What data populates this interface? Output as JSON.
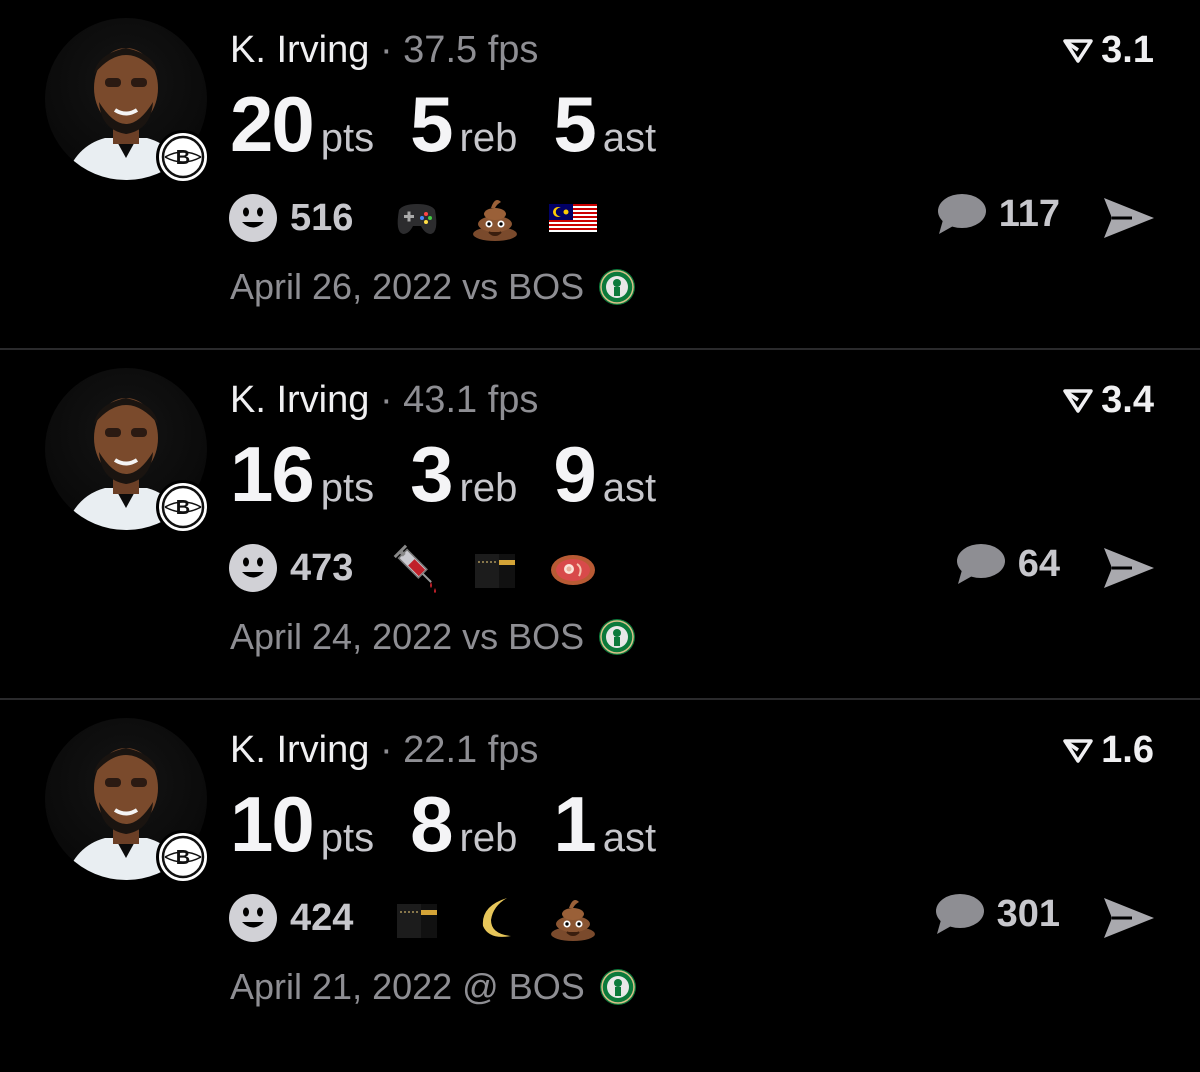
{
  "cards": [
    {
      "player": "K. Irving",
      "separator": "·",
      "fps": "37.5 fps",
      "rating": "3.1",
      "pts": "20",
      "pts_label": "pts",
      "reb": "5",
      "reb_label": "reb",
      "ast": "5",
      "ast_label": "ast",
      "reaction_count": "516",
      "emojis": [
        "video-game-icon",
        "poop-icon",
        "malaysia-flag-icon"
      ],
      "comment_count": "117",
      "date": "April 26, 2022 vs BOS"
    },
    {
      "player": "K. Irving",
      "separator": "·",
      "fps": "43.1 fps",
      "rating": "3.4",
      "pts": "16",
      "pts_label": "pts",
      "reb": "3",
      "reb_label": "reb",
      "ast": "9",
      "ast_label": "ast",
      "reaction_count": "473",
      "emojis": [
        "syringe-icon",
        "kaaba-icon",
        "meat-icon"
      ],
      "comment_count": "64",
      "date": "April 24, 2022 vs BOS"
    },
    {
      "player": "K. Irving",
      "separator": "·",
      "fps": "22.1 fps",
      "rating": "1.6",
      "pts": "10",
      "pts_label": "pts",
      "reb": "8",
      "reb_label": "reb",
      "ast": "1",
      "ast_label": "ast",
      "reaction_count": "424",
      "emojis": [
        "kaaba-icon",
        "crescent-moon-icon",
        "poop-icon"
      ],
      "comment_count": "301",
      "date": "April 21, 2022 @ BOS"
    }
  ],
  "colors": {
    "background": "#000000",
    "primary_text": "#f0f0f2",
    "secondary_text": "#8e8e93",
    "icon_gray": "#8e8e93",
    "celtics_green": "#0b7a3b"
  }
}
